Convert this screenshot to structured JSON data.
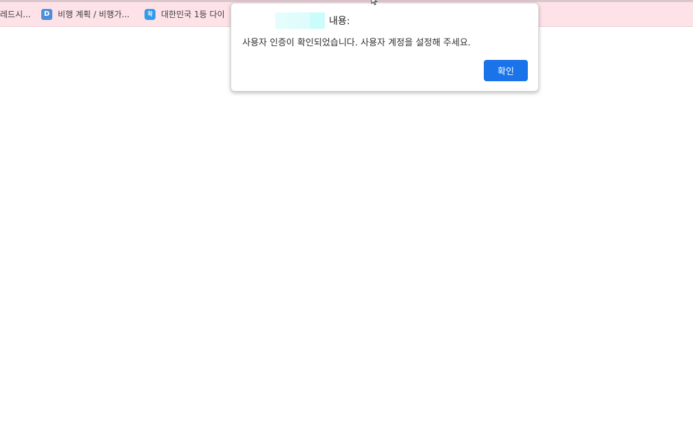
{
  "bookmarks": {
    "items": [
      {
        "label": "레드시..."
      },
      {
        "label": "비행 계획 / 비행가...",
        "icon_text": "D"
      },
      {
        "label": "대한민국 1등 다이",
        "icon_text": "착"
      }
    ]
  },
  "dialog": {
    "origin_suffix": "내용:",
    "message": "사용자 인증이 확인되었습니다. 사용자 계정을 설정해 주세요.",
    "ok_label": "확인"
  },
  "colors": {
    "bookmark_bar": "#fde2e8",
    "button_accent": "#1a73e8"
  }
}
